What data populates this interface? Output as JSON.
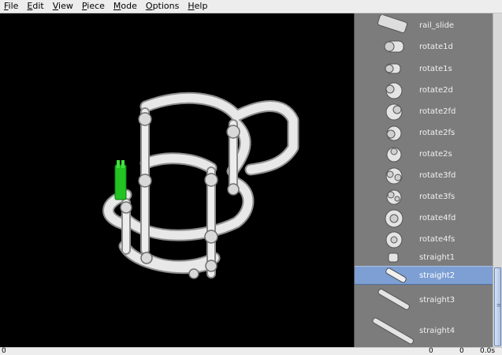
{
  "menu": [
    {
      "mnemonic": "F",
      "rest": "ile"
    },
    {
      "mnemonic": "E",
      "rest": "dit"
    },
    {
      "mnemonic": "V",
      "rest": "iew"
    },
    {
      "mnemonic": "P",
      "rest": "iece"
    },
    {
      "mnemonic": "M",
      "rest": "ode"
    },
    {
      "mnemonic": "O",
      "rest": "ptions"
    },
    {
      "mnemonic": "H",
      "rest": "elp"
    }
  ],
  "pieces": [
    {
      "label": "rail_slide",
      "icon": "rail-slide-icon"
    },
    {
      "label": "rotate1d",
      "icon": "rotate1d-icon"
    },
    {
      "label": "rotate1s",
      "icon": "rotate1s-icon"
    },
    {
      "label": "rotate2d",
      "icon": "rotate2d-icon"
    },
    {
      "label": "rotate2fd",
      "icon": "rotate2fd-icon"
    },
    {
      "label": "rotate2fs",
      "icon": "rotate2fs-icon"
    },
    {
      "label": "rotate2s",
      "icon": "rotate2s-icon"
    },
    {
      "label": "rotate3fd",
      "icon": "rotate3fd-icon"
    },
    {
      "label": "rotate3fs",
      "icon": "rotate3fs-icon"
    },
    {
      "label": "rotate4fd",
      "icon": "rotate4fd-icon"
    },
    {
      "label": "rotate4fs",
      "icon": "rotate4fs-icon"
    },
    {
      "label": "straight1",
      "icon": "straight1-icon"
    },
    {
      "label": "straight2",
      "icon": "straight2-icon",
      "selected": true
    },
    {
      "label": "straight3",
      "icon": "straight3-icon"
    },
    {
      "label": "straight4",
      "icon": "straight4-icon"
    }
  ],
  "status": {
    "left": "0",
    "count_a": "0",
    "count_b": "0",
    "time": "0.0s"
  },
  "colors": {
    "viewport_bg": "#000000",
    "pipe": "#e6e6e6",
    "pipe_shadow": "#9a9a9a",
    "active_piece": "#2fd12f",
    "palette_bg": "#7c7c7c",
    "selection": "#7d9fd3"
  }
}
